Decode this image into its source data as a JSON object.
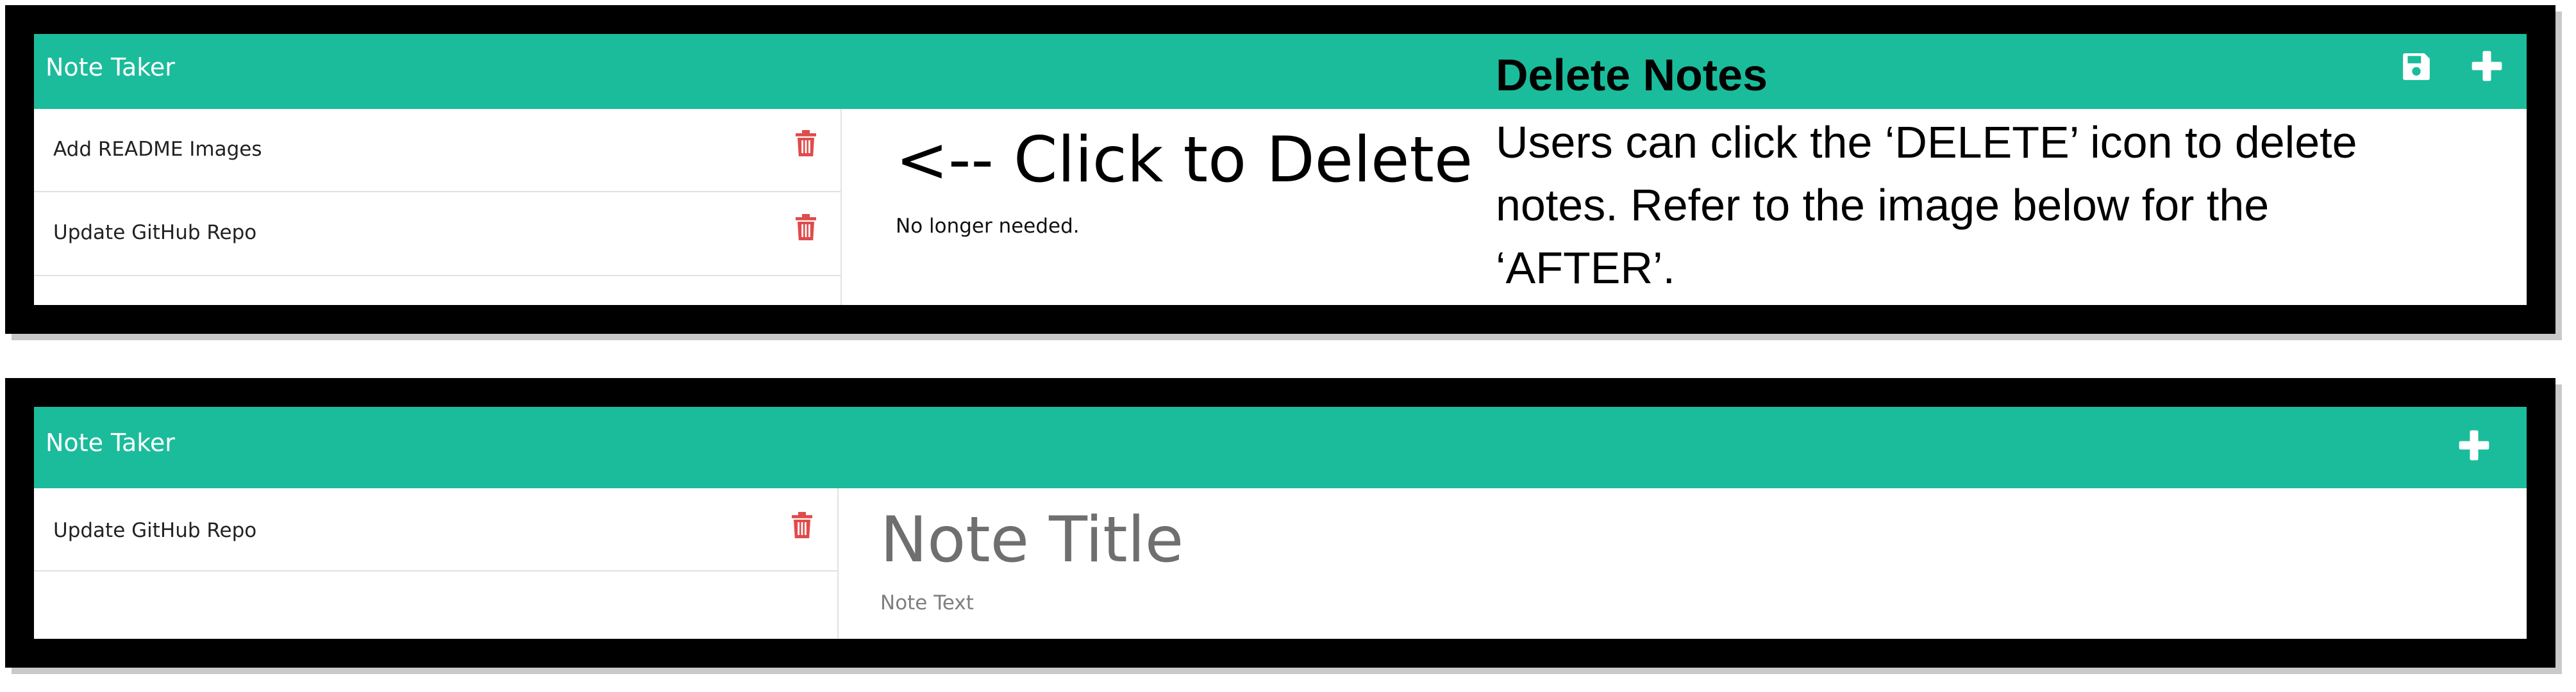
{
  "colors": {
    "navbar": "#1bbc9b",
    "trash": "#e04b4b",
    "frame": "#000000"
  },
  "before": {
    "app_title": "Note Taker",
    "icons": [
      "save-icon",
      "plus-icon",
      "trash-icon"
    ],
    "notes": [
      {
        "title": "Add README Images"
      },
      {
        "title": "Update GitHub Repo"
      }
    ],
    "active_note": {
      "title": "<-- Click to Delete",
      "text": "No longer needed."
    },
    "annotation": {
      "heading": "Delete Notes",
      "body": "Users can click the ‘DELETE’ icon to delete notes. Refer to the image below for the ‘AFTER’."
    }
  },
  "after": {
    "app_title": "Note Taker",
    "icons": [
      "plus-icon",
      "trash-icon"
    ],
    "notes": [
      {
        "title": "Update GitHub Repo"
      }
    ],
    "editor": {
      "title_placeholder": "Note Title",
      "text_placeholder": "Note Text"
    }
  }
}
